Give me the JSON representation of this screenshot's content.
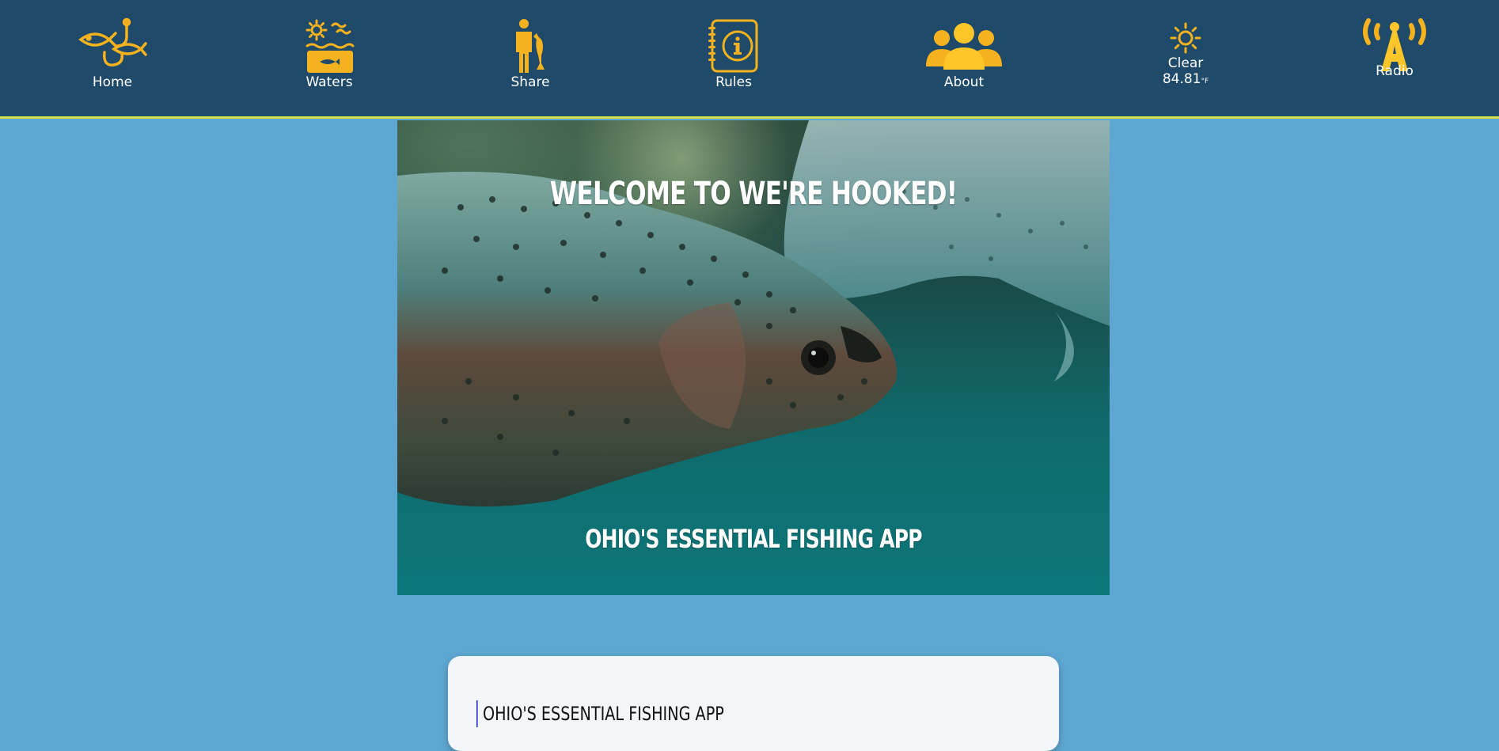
{
  "nav": {
    "items": [
      {
        "label": "Home",
        "icon": "fish-hook-icon"
      },
      {
        "label": "Waters",
        "icon": "waters-icon"
      },
      {
        "label": "Share",
        "icon": "share-person-fish-icon"
      },
      {
        "label": "Rules",
        "icon": "info-notebook-icon"
      },
      {
        "label": "About",
        "icon": "group-icon"
      },
      {
        "label": "Radio",
        "icon": "radio-antenna-icon"
      }
    ],
    "weather": {
      "condition": "Clear",
      "temperature": "84.81",
      "unit": "°F",
      "icon": "sun-icon"
    }
  },
  "hero": {
    "title": "WELCOME TO WE'RE HOOKED!",
    "subtitle": "OHIO'S ESSENTIAL FISHING APP"
  },
  "card": {
    "heading": "OHIO'S ESSENTIAL FISHING APP"
  },
  "colors": {
    "nav_background": "#1f4a69",
    "nav_border": "#d2e04a",
    "page_background": "#5ea7d3",
    "icon_gold": "#f5b21f",
    "card_background": "#f2f6f9"
  }
}
